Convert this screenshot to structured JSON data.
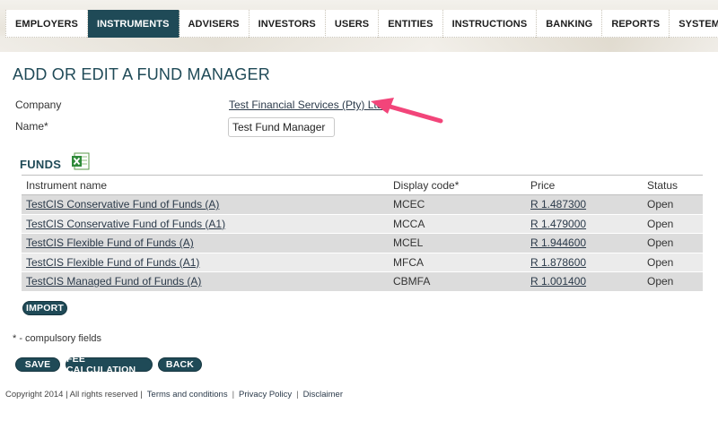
{
  "nav": {
    "items": [
      {
        "label": "EMPLOYERS"
      },
      {
        "label": "INSTRUMENTS"
      },
      {
        "label": "ADVISERS"
      },
      {
        "label": "INVESTORS"
      },
      {
        "label": "USERS"
      },
      {
        "label": "ENTITIES"
      },
      {
        "label": "INSTRUCTIONS"
      },
      {
        "label": "BANKING"
      },
      {
        "label": "REPORTS"
      },
      {
        "label": "SYSTEM"
      }
    ],
    "active": "INSTRUMENTS"
  },
  "page_title": "ADD OR EDIT A FUND MANAGER",
  "form": {
    "company_label": "Company",
    "company_value": "Test Financial Services (Pty) Ltd",
    "name_label": "Name*",
    "name_value": "Test Fund Manager"
  },
  "funds": {
    "title": "FUNDS",
    "export_icon": "excel-icon",
    "columns": [
      "Instrument name",
      "Display code*",
      "Price",
      "Status"
    ],
    "rows": [
      {
        "name": "TestCIS Conservative Fund of Funds (A)",
        "code": "MCEC",
        "price": "R 1.487300",
        "status": "Open"
      },
      {
        "name": "TestCIS Conservative Fund of Funds (A1)",
        "code": "MCCA",
        "price": "R 1.479000",
        "status": "Open"
      },
      {
        "name": "TestCIS Flexible Fund of Funds (A)",
        "code": "MCEL",
        "price": "R 1.944600",
        "status": "Open"
      },
      {
        "name": "TestCIS Flexible Fund of Funds (A1)",
        "code": "MFCA",
        "price": "R 1.878600",
        "status": "Open"
      },
      {
        "name": "TestCIS Managed Fund of Funds (A)",
        "code": "CBMFA",
        "price": "R 1.001400",
        "status": "Open"
      }
    ],
    "import_label": "IMPORT"
  },
  "compulsory_note": "* - compulsory fields",
  "actions": {
    "save_label": "SAVE",
    "fee_label": "FEE CALCULATION",
    "back_label": "BACK"
  },
  "footer": {
    "copyright": "Copyright 2014 | All rights reserved |",
    "terms": "Terms and conditions",
    "privacy": "Privacy Policy",
    "disclaimer": "Disclaimer",
    "separator": "|"
  },
  "colors": {
    "brand": "#1f4a57",
    "arrow": "#f2457a"
  }
}
